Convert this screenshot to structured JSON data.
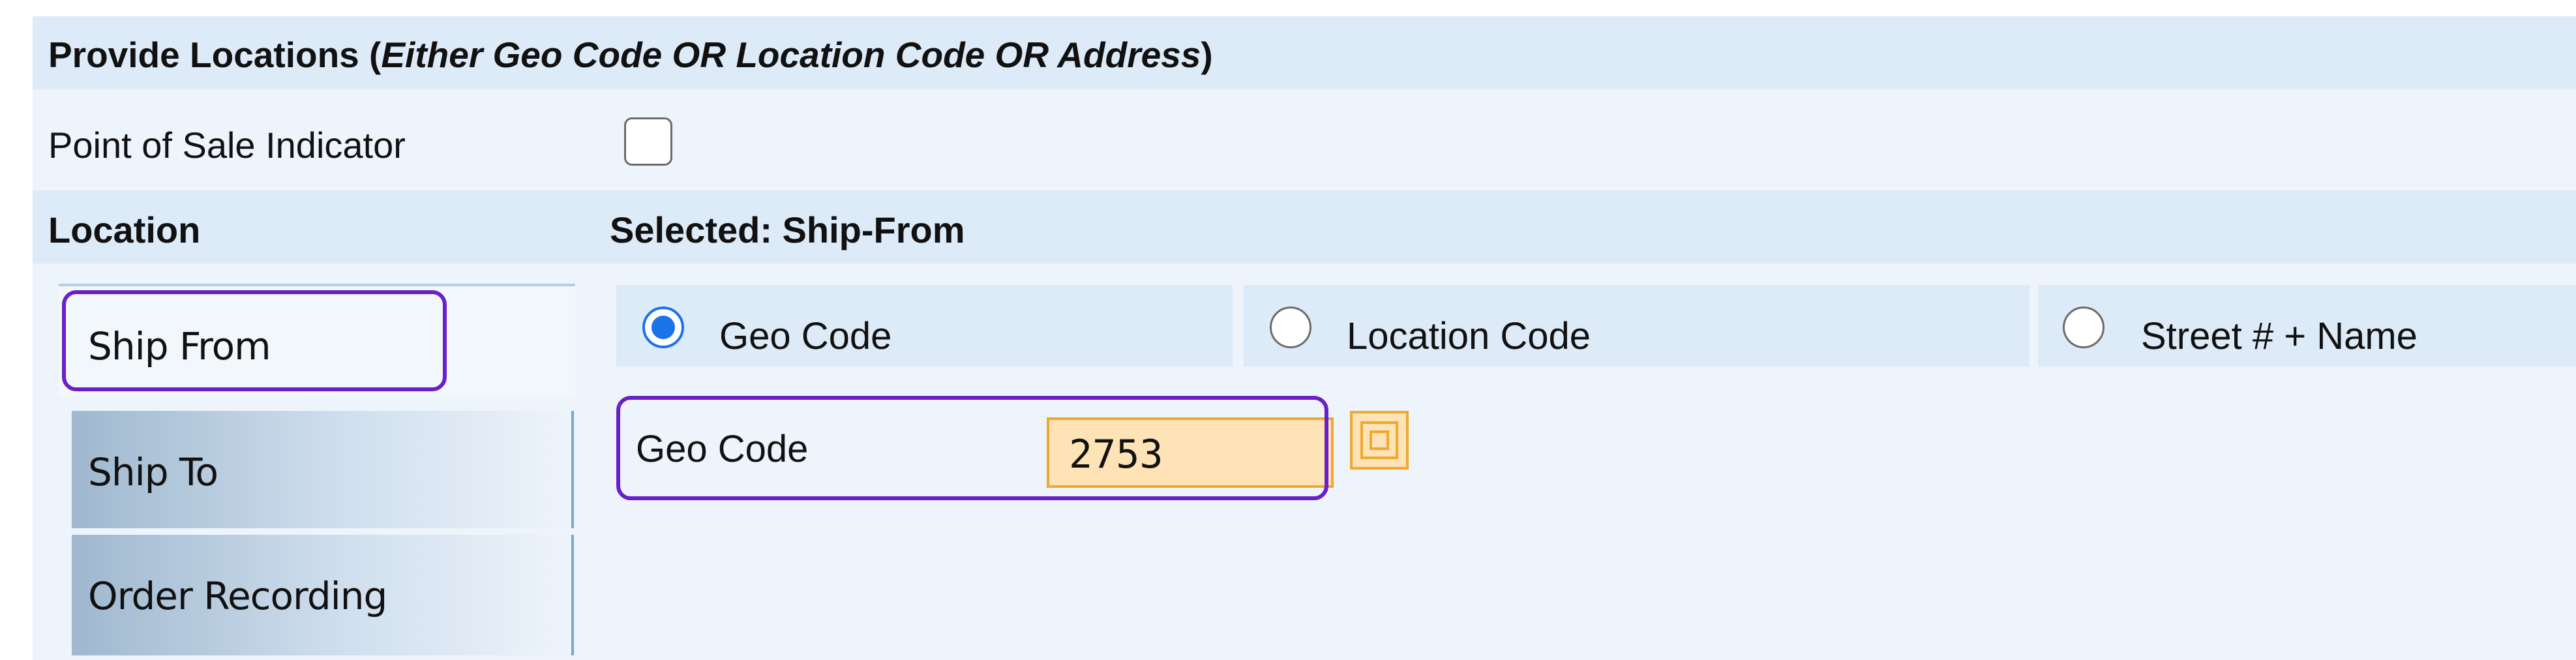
{
  "header": {
    "title_prefix": "Provide Locations (",
    "title_italic": "Either Geo Code OR Location Code OR Address",
    "title_suffix": ")"
  },
  "point_of_sale": {
    "label": "Point of Sale Indicator",
    "checked": false
  },
  "location_section": {
    "label": "Location",
    "selected_label": "Selected: Ship-From"
  },
  "tabs": [
    {
      "label": "Ship From",
      "active": true
    },
    {
      "label": "Ship To",
      "active": false
    },
    {
      "label": "Order Recording",
      "active": false
    }
  ],
  "options": [
    {
      "label": "Geo Code",
      "selected": true
    },
    {
      "label": "Location Code",
      "selected": false
    },
    {
      "label": "Street # + Name",
      "selected": false
    }
  ],
  "geo_code": {
    "label": "Geo Code",
    "value": "2753"
  },
  "colors": {
    "accent": "#1a73e8",
    "highlight": "#6a1fc8",
    "input_bg": "#fde3b5",
    "input_border": "#f0a82e",
    "header_bg": "#ddeaf7",
    "panel_bg": "#eef4fb"
  }
}
